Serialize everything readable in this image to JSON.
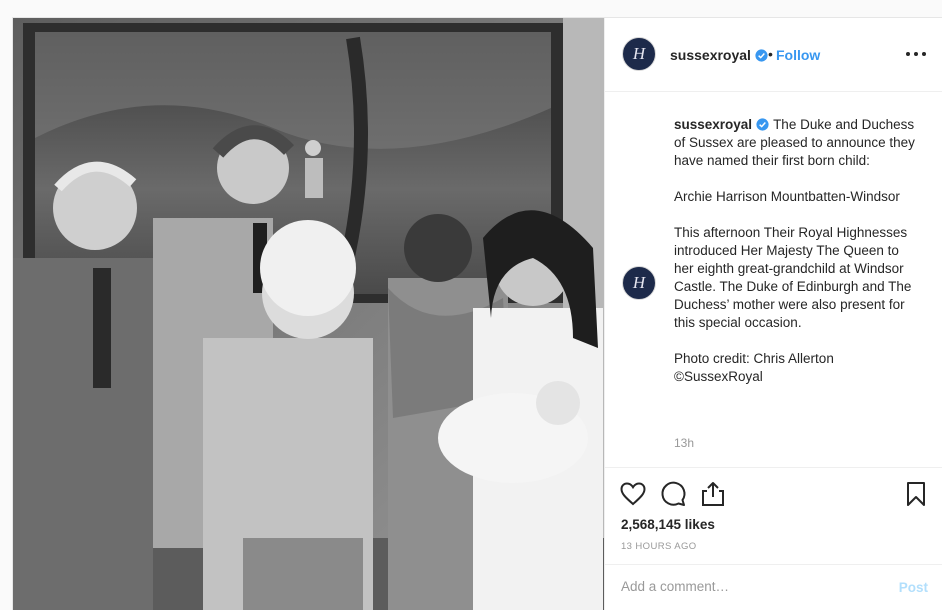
{
  "account": {
    "username": "sussexroyal",
    "avatar_monogram": "H",
    "verified": true,
    "follow_label": "Follow",
    "separator": "•"
  },
  "caption": {
    "username": "sussexroyal",
    "paragraphs": [
      "The Duke and Duchess of Sussex are pleased to announce they have named their first born child:",
      "Archie Harrison Mountbatten-Windsor",
      "This afternoon Their Royal Highnesses introduced Her Majesty The Queen to her eighth great-grandchild at Windsor Castle. The Duke of Edinburgh and The Duchess’ mother were also present for this special occasion.",
      "Photo credit: Chris Allerton ©SussexRoyal"
    ],
    "time": "13h"
  },
  "engagement": {
    "likes": "2,568,145 likes",
    "posted_ago": "13 HOURS AGO"
  },
  "comment": {
    "placeholder": "Add a comment…",
    "post_label": "Post"
  },
  "icons": {
    "verified": "verified-badge-icon",
    "more": "more-options-icon",
    "like": "heart-icon",
    "comment": "comment-bubble-icon",
    "share": "share-icon",
    "save": "bookmark-icon"
  },
  "colors": {
    "link_blue": "#3897f0",
    "post_disabled": "#b2dffc",
    "avatar_navy": "#1d2a4a",
    "muted_text": "#999999"
  }
}
